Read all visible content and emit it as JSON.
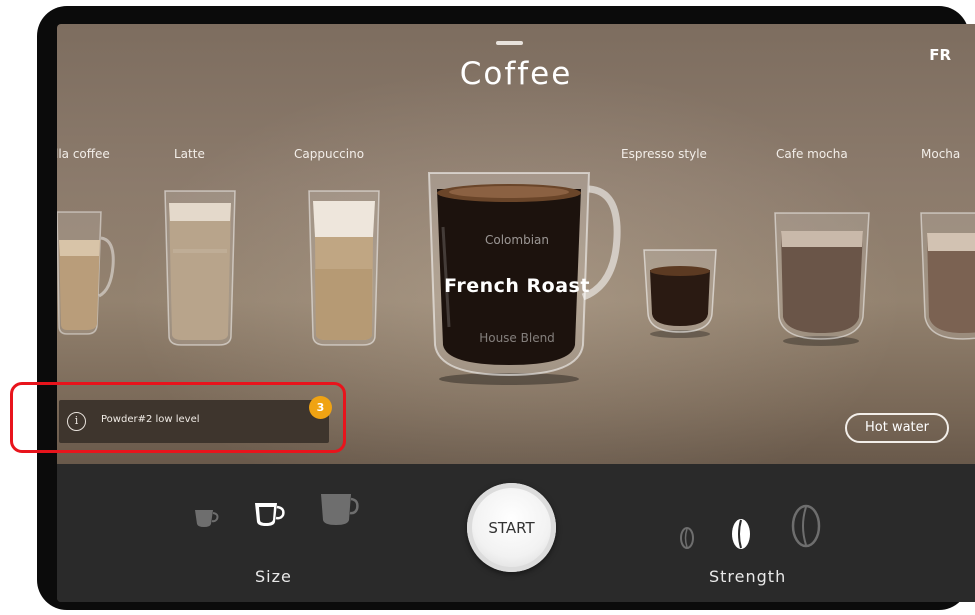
{
  "header": {
    "title": "Coffee",
    "language": "FR"
  },
  "drinks": [
    {
      "label": "lla coffee"
    },
    {
      "label": "Latte"
    },
    {
      "label": "Cappuccino"
    },
    {
      "label": "Espresso style"
    },
    {
      "label": "Cafe mocha"
    },
    {
      "label": "Mocha"
    }
  ],
  "carousel": {
    "above": "Colombian",
    "selected": "French Roast",
    "below": "House Blend"
  },
  "notification": {
    "text": "Powder#2 low level",
    "badge_count": "3",
    "icon": "info-icon"
  },
  "hot_water_label": "Hot water",
  "controls": {
    "size_label": "Size",
    "size_options": [
      "small",
      "medium",
      "large"
    ],
    "size_selected": "medium",
    "start_label": "START",
    "strength_label": "Strength",
    "strength_options": [
      "mild",
      "medium",
      "strong"
    ],
    "strength_selected": "medium"
  },
  "colors": {
    "highlight": "#e8141c",
    "badge": "#f0a313",
    "bottom_bar": "#2a2a2a"
  }
}
